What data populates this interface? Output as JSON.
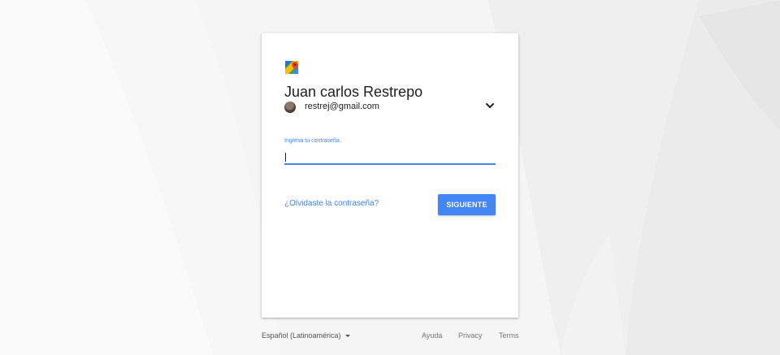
{
  "app": {
    "logo_icon": "google-maps-icon"
  },
  "account": {
    "name": "Juan carlos Restrepo",
    "email": "restrej@gmail.com",
    "avatar": "user-avatar",
    "switch_icon": "chevron-down-icon"
  },
  "password": {
    "label": "Ingresa tu contraseña.",
    "value": ""
  },
  "actions": {
    "forgot_label": "¿Olvidaste la contraseña?",
    "next_label": "SIGUIENTE"
  },
  "footer": {
    "language": "Español (Latinoamérica)",
    "links": [
      "Ayuda",
      "Privacy",
      "Terms"
    ]
  },
  "colors": {
    "accent": "#4285f4",
    "card_bg": "#ffffff",
    "page_bg": "#f4f4f4"
  }
}
